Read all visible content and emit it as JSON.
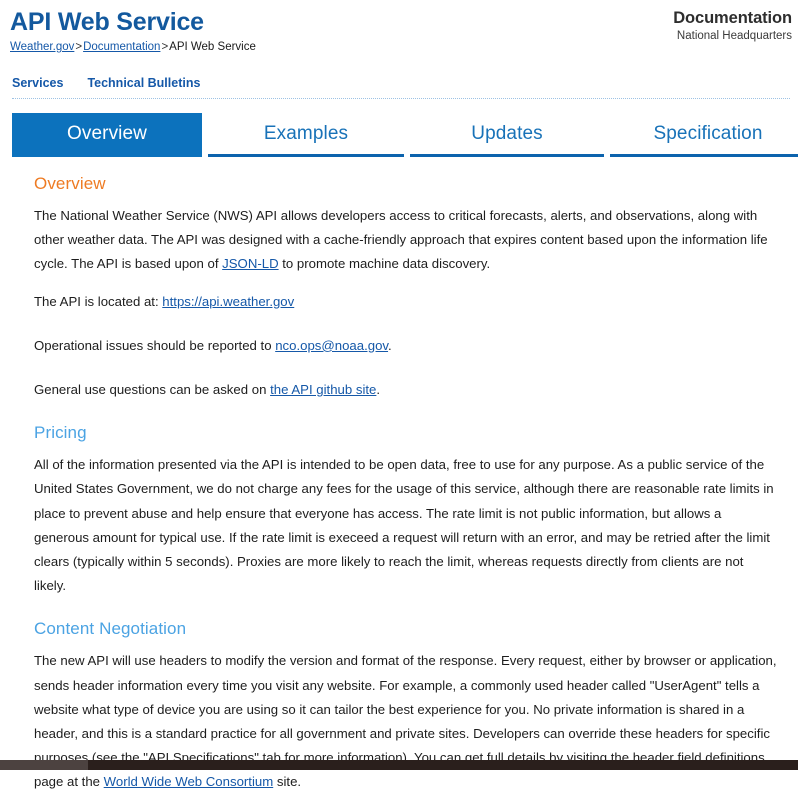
{
  "header": {
    "site_title": "API Web Service",
    "breadcrumb": {
      "item1": "Weather.gov",
      "sep1": ">",
      "item2": "Documentation",
      "sep2": ">",
      "current": "API Web Service"
    },
    "office_title": "Documentation",
    "office_sub": "National Headquarters"
  },
  "subnav": {
    "items": [
      {
        "label": "Services"
      },
      {
        "label": "Technical Bulletins"
      }
    ]
  },
  "tabs": [
    {
      "label": "Overview",
      "active": true
    },
    {
      "label": "Examples",
      "active": false
    },
    {
      "label": "Updates",
      "active": false
    },
    {
      "label": "Specification",
      "active": false
    }
  ],
  "content": {
    "overview": {
      "heading": "Overview",
      "para1_a": "The National Weather Service (NWS) API allows developers access to critical forecasts, alerts, and observations, along with other weather data. The API was designed with a cache-friendly approach that expires content based upon the information life cycle. The API is based upon of ",
      "para1_link": "JSON-LD",
      "para1_b": " to promote machine data discovery.",
      "para2_a": "The API is located at: ",
      "para2_link": "https://api.weather.gov",
      "para3_a": "Operational issues should be reported to ",
      "para3_link": "nco.ops@noaa.gov",
      "para3_b": ".",
      "para4_a": "General use questions can be asked on ",
      "para4_link": "the API github site",
      "para4_b": "."
    },
    "pricing": {
      "heading": "Pricing",
      "para1": "All of the information presented via the API is intended to be open data, free to use for any purpose. As a public service of the United States Government, we do not charge any fees for the usage of this service, although there are reasonable rate limits in place to prevent abuse and help ensure that everyone has access. The rate limit is not public information, but allows a generous amount for typical use. If the rate limit is execeed a request will return with an error, and may be retried after the limit clears (typically within 5 seconds). Proxies are more likely to reach the limit, whereas requests directly from clients are not likely."
    },
    "content_negotiation": {
      "heading": "Content Negotiation",
      "para1_a": "The new API will use headers to modify the version and format of the response. Every request, either by browser or application, sends header information every time you visit any website. For example, a commonly used header called \"UserAgent\" tells a website what type of device you are using so it can tailor the best experience for you. No private information is shared in a header, and this is a standard practice for all government and private sites. Developers can override these headers for specific purposes (see the \"API Specifications\" tab for more information). You can get full details by visiting the header field definitions page at the ",
      "para1_link": "World Wide Web Consortium",
      "para1_b": " site."
    }
  },
  "colors": {
    "brand_blue": "#0c72bd",
    "title_blue": "#13599e",
    "link_blue": "#1558a8",
    "accent_orange": "#ee7b23",
    "heading_light_blue": "#4ba3e3"
  }
}
